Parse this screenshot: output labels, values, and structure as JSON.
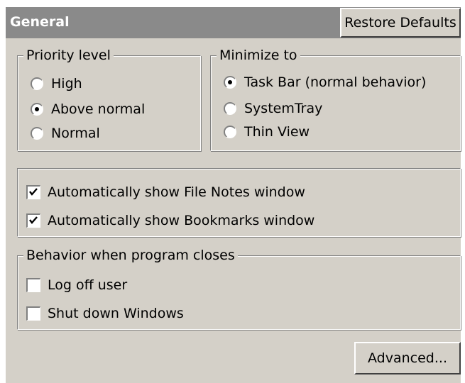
{
  "header": {
    "title": "General",
    "restore_label": "Restore Defaults"
  },
  "priority": {
    "legend": "Priority level",
    "options": [
      {
        "label": "High",
        "checked": false
      },
      {
        "label": "Above normal",
        "checked": true
      },
      {
        "label": "Normal",
        "checked": false
      }
    ]
  },
  "minimize": {
    "legend": "Minimize to",
    "options": [
      {
        "label": "Task Bar (normal behavior)",
        "checked": true
      },
      {
        "label": "SystemTray",
        "checked": false
      },
      {
        "label": "Thin View",
        "checked": false
      }
    ]
  },
  "auto_show": {
    "items": [
      {
        "label": "Automatically show File Notes window",
        "checked": true
      },
      {
        "label": "Automatically show Bookmarks window",
        "checked": true
      }
    ]
  },
  "close_behavior": {
    "legend": "Behavior when program closes",
    "items": [
      {
        "label": "Log off user",
        "checked": false
      },
      {
        "label": "Shut down Windows",
        "checked": false
      }
    ]
  },
  "footer": {
    "advanced_label": "Advanced..."
  },
  "colors": {
    "panel_bg": "#d4d0c8",
    "header_bg": "#8a8a8a",
    "header_text": "#ffffff"
  }
}
